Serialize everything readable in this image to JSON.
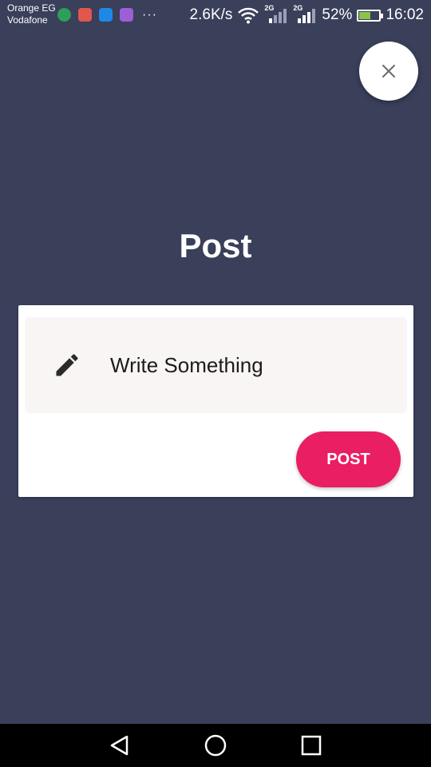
{
  "status_bar": {
    "carrier_1": "Orange EG",
    "carrier_2": "Vodafone",
    "notification_icon_colors": [
      "#2e9e5b",
      "#e2574c",
      "#1e88e5",
      "#9c5fd6"
    ],
    "more": "···",
    "speed": "2.6K/s",
    "network_1": "2G",
    "network_2": "2G",
    "battery": "52%",
    "battery_level": 0.52,
    "time": "16:02"
  },
  "page": {
    "title": "Post"
  },
  "composer": {
    "placeholder": "Write Something",
    "post_button": "POST"
  },
  "icons": {
    "close": "close-icon",
    "edit": "pencil-icon",
    "nav_back": "back-triangle-icon",
    "nav_home": "home-circle-icon",
    "nav_recents": "recents-square-icon"
  },
  "colors": {
    "background": "#3a3f5a",
    "accent": "#e91e63",
    "card": "#ffffff",
    "input_background": "#f8f5f4"
  }
}
